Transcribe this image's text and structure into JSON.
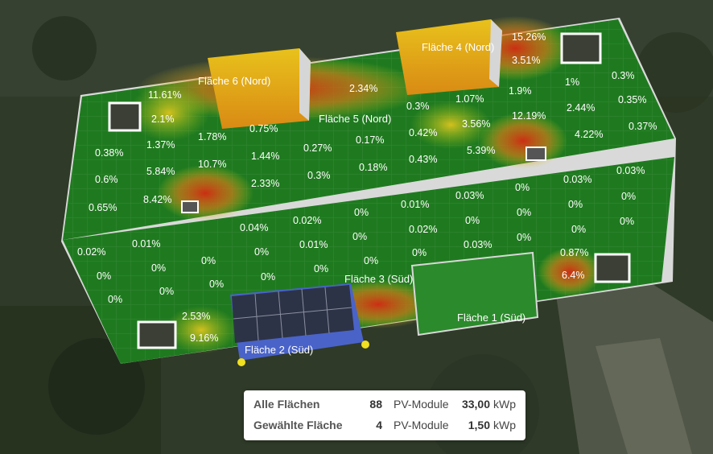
{
  "planes": [
    {
      "id": "flaeche-1",
      "label": "Fläche 1 (Süd)"
    },
    {
      "id": "flaeche-2",
      "label": "Fläche 2 (Süd)"
    },
    {
      "id": "flaeche-3",
      "label": "Fläche 3 (Süd)"
    },
    {
      "id": "flaeche-4",
      "label": "Fläche 4 (Nord)"
    },
    {
      "id": "flaeche-5",
      "label": "Fläche 5 (Nord)"
    },
    {
      "id": "flaeche-6",
      "label": "Fläche 6 (Nord)"
    }
  ],
  "shading_values": {
    "north_roof": [
      "15.26%",
      "3.51%",
      "11.61%",
      "2.1%",
      "2.34%",
      "1%",
      "0.3%",
      "0.3%",
      "1.07%",
      "1.9%",
      "2.44%",
      "0.35%",
      "0.75%",
      "12.19%",
      "0.37%",
      "1.78%",
      "3.56%",
      "4.22%",
      "0.38%",
      "1.37%",
      "0.27%",
      "0.17%",
      "0.42%",
      "1.44%",
      "5.39%",
      "10.7%",
      "5.84%",
      "0.6%",
      "0.3%",
      "0.18%",
      "0.43%",
      "0.03%",
      "2.33%",
      "8.42%",
      "0.65%"
    ],
    "south_roof": [
      "0.03%",
      "0%",
      "0.01%",
      "0.03%",
      "0%",
      "0%",
      "0.02%",
      "0%",
      "0%",
      "0%",
      "0%",
      "0%",
      "0.04%",
      "0.02%",
      "0.01%",
      "0.01%",
      "0%",
      "0.02%",
      "0.03%",
      "0%",
      "0%",
      "0%",
      "0%",
      "0%",
      "0%",
      "0.87%",
      "0%",
      "0%",
      "0%",
      "0%",
      "6.4%",
      "0%",
      "0%",
      "2.53%",
      "9.16%"
    ]
  },
  "summary": {
    "rows": [
      {
        "label": "Alle Flächen",
        "count": "88",
        "unit": "PV-Module",
        "kwp": "33,00",
        "kwp_unit": "kWp"
      },
      {
        "label": "Gewählte Fläche",
        "count": "4",
        "unit": "PV-Module",
        "kwp": "1,50",
        "kwp_unit": "kWp"
      }
    ]
  },
  "colors": {
    "roof_green": "#1f7a1f",
    "hot_red": "#d42a12",
    "warm_yellow": "#e2c21e",
    "selected_blue": "#4a63c9",
    "handle_yellow": "#f0e020"
  }
}
